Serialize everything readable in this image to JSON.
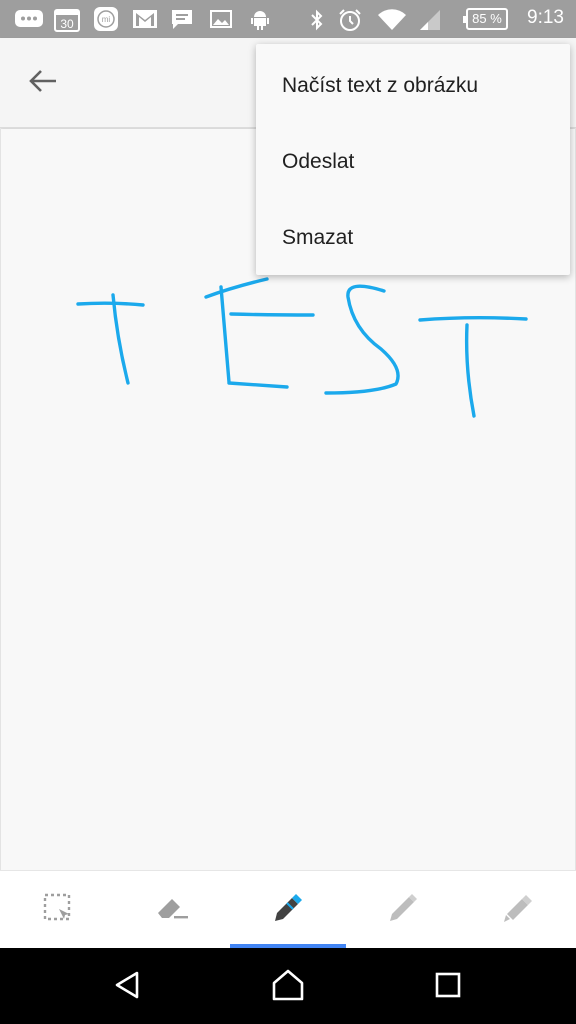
{
  "status_bar": {
    "calendar_day": "30",
    "battery_percent": "85 %",
    "time": "9:13",
    "icons": [
      "message-bubble-icon",
      "calendar-icon",
      "mi-app-icon",
      "gmail-icon",
      "chat-icon",
      "gallery-icon",
      "android-icon",
      "bluetooth-icon",
      "alarm-icon",
      "wifi-icon",
      "cell-signal-icon",
      "battery-icon"
    ]
  },
  "app_bar": {
    "back_icon": "arrow-back-icon"
  },
  "menu": {
    "items": [
      "Načíst text z obrázku",
      "Odeslat",
      "Smazat"
    ]
  },
  "drawing": {
    "stroke_color": "#1ba9ec",
    "strokes": [
      "T",
      "E",
      "S",
      "T"
    ]
  },
  "toolbar": {
    "tools": [
      "lasso-select-icon",
      "eraser-icon",
      "pen-icon",
      "pencil-icon",
      "highlighter-icon"
    ],
    "active_index": 2,
    "accent_color": "#4285f4"
  },
  "nav_bar": {
    "buttons": [
      "back-triangle-icon",
      "home-circle-icon",
      "recents-square-icon"
    ]
  }
}
